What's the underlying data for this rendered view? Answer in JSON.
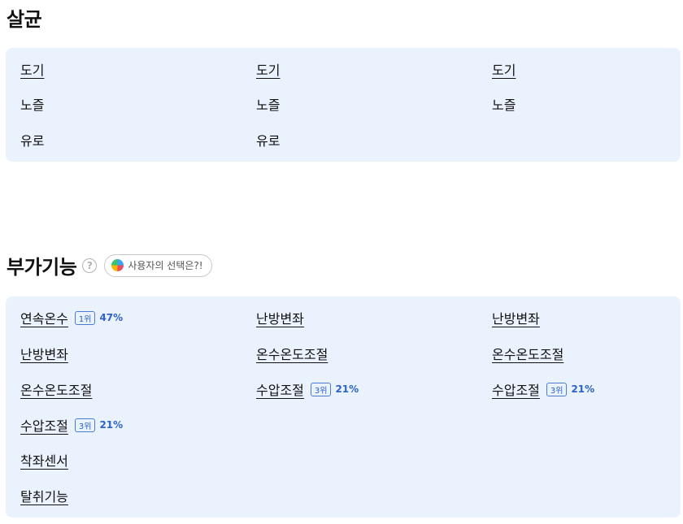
{
  "sterilize": {
    "title": "살균",
    "items": [
      {
        "label": "도기",
        "underline": true
      },
      {
        "label": "도기",
        "underline": true
      },
      {
        "label": "도기",
        "underline": true
      },
      {
        "label": "노즐",
        "underline": false
      },
      {
        "label": "노즐",
        "underline": false
      },
      {
        "label": "노즐",
        "underline": false
      },
      {
        "label": "유로",
        "underline": false
      },
      {
        "label": "유로",
        "underline": false
      }
    ]
  },
  "addon": {
    "title": "부가기능",
    "help_symbol": "?",
    "choice_chip_label": "사용자의 선택은?!",
    "items": [
      {
        "label": "연속온수",
        "rank": "1위",
        "pct": "47%"
      },
      {
        "label": "난방변좌"
      },
      {
        "label": "난방변좌"
      },
      {
        "label": "난방변좌"
      },
      {
        "label": "온수온도조절"
      },
      {
        "label": "온수온도조절"
      },
      {
        "label": "온수온도조절"
      },
      {
        "label": "수압조절",
        "rank": "3위",
        "pct": "21%"
      },
      {
        "label": "수압조절",
        "rank": "3위",
        "pct": "21%"
      },
      {
        "label": "수압조절",
        "rank": "3위",
        "pct": "21%"
      },
      {
        "label": "착좌센서"
      },
      {
        "label": "탈취기능"
      }
    ]
  },
  "colors": {
    "panel_bg": "#eaf2fe",
    "accent": "#2d62c9"
  }
}
